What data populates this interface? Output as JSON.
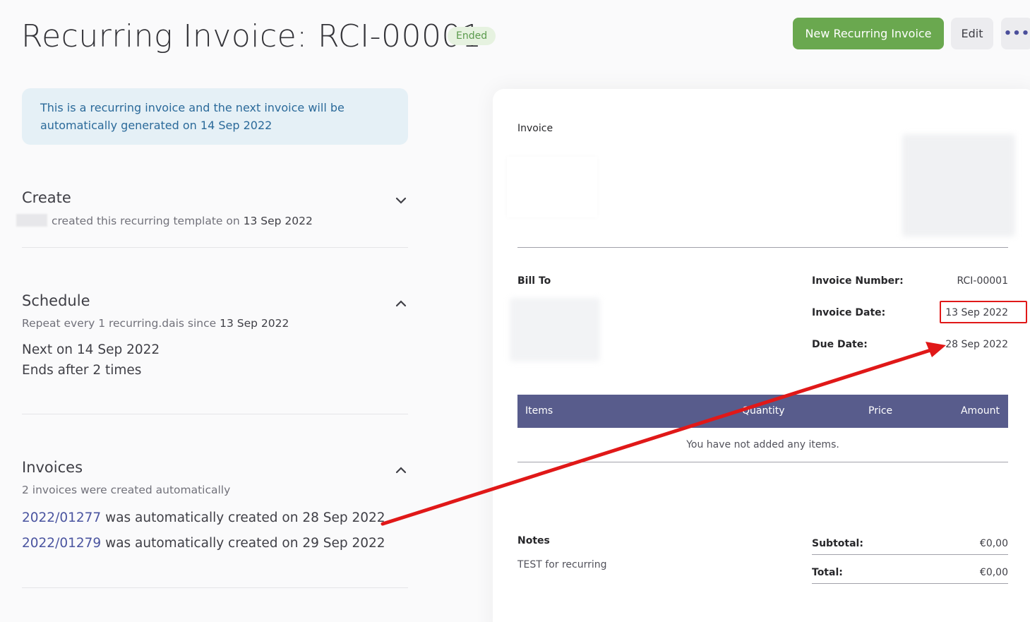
{
  "header": {
    "title": "Recurring Invoice: RCI-00001",
    "status": "Ended",
    "new_button": "New Recurring Invoice",
    "edit_button": "Edit",
    "more_button": "•••"
  },
  "banner": {
    "text": "This is a recurring invoice and the next invoice will be automatically generated on 14 Sep 2022"
  },
  "create": {
    "title": "Create",
    "text": "created this recurring template on",
    "date": "13 Sep 2022"
  },
  "schedule": {
    "title": "Schedule",
    "repeat_text": "Repeat every 1 recurring.dais since",
    "repeat_date": "13 Sep 2022",
    "next": "Next on 14 Sep 2022",
    "ends": "Ends after 2 times"
  },
  "invoices": {
    "title": "Invoices",
    "subtitle": "2 invoices were created automatically",
    "items": [
      {
        "number": "2022/01277",
        "text": "was automatically created on 28 Sep 2022"
      },
      {
        "number": "2022/01279",
        "text": "was automatically created on 29 Sep 2022"
      }
    ]
  },
  "invoice_preview": {
    "heading": "Invoice",
    "bill_to": "Bill To",
    "invoice_number_label": "Invoice Number:",
    "invoice_number": "RCI-00001",
    "invoice_date_label": "Invoice Date:",
    "invoice_date": "13 Sep 2022",
    "due_date_label": "Due Date:",
    "due_date": "28 Sep 2022",
    "columns": [
      "Items",
      "Quantity",
      "Price",
      "Amount"
    ],
    "empty_text": "You have not added any items.",
    "notes_label": "Notes",
    "notes": "TEST for recurring",
    "subtotal_label": "Subtotal:",
    "subtotal": "€0,00",
    "total_label": "Total:",
    "total": "€0,00"
  },
  "colors": {
    "primary_button": "#6aa84f",
    "table_header": "#585c8c",
    "annotation": "#e01818",
    "banner_bg": "#e5f0f6",
    "link": "#4b55a0"
  }
}
